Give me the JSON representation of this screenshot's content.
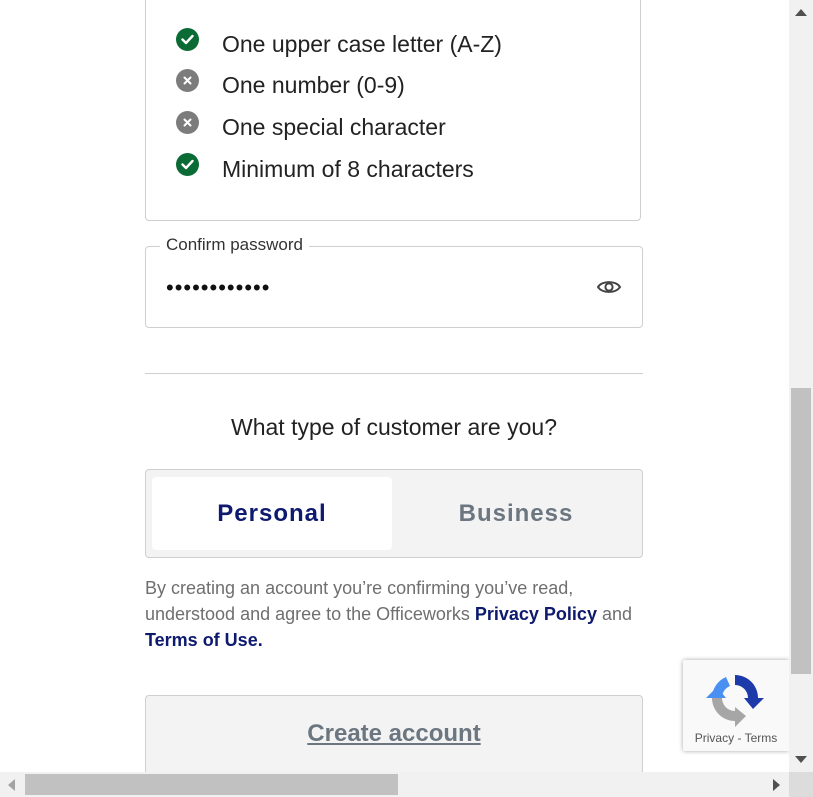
{
  "password_requirements": [
    {
      "label": "One upper case letter (A-Z)",
      "status": "met",
      "icon": "check-icon"
    },
    {
      "label": "One number (0-9)",
      "status": "unmet",
      "icon": "cross-icon"
    },
    {
      "label": "One special character",
      "status": "unmet",
      "icon": "cross-icon"
    },
    {
      "label": "Minimum of 8 characters",
      "status": "met",
      "icon": "check-icon"
    }
  ],
  "confirm_password": {
    "label": "Confirm password",
    "value": "••••••••••••",
    "icon": "eye-icon"
  },
  "customer_type": {
    "question": "What type of customer are you?",
    "options": [
      "Personal",
      "Business"
    ],
    "selected": "Personal"
  },
  "terms": {
    "prefix": "By creating an account you’re confirming you’ve read, understood and agree to the Officeworks ",
    "privacy_link": "Privacy Policy",
    "middle": " and ",
    "terms_link": "Terms of Use."
  },
  "create_button": "Create account",
  "recaptcha": {
    "privacy": "Privacy",
    "separator": " - ",
    "terms": "Terms"
  },
  "colors": {
    "check": "#0a6b35",
    "cross": "#7c7c7c",
    "brand_navy": "#0d1a6e",
    "muted": "#6b7680"
  }
}
